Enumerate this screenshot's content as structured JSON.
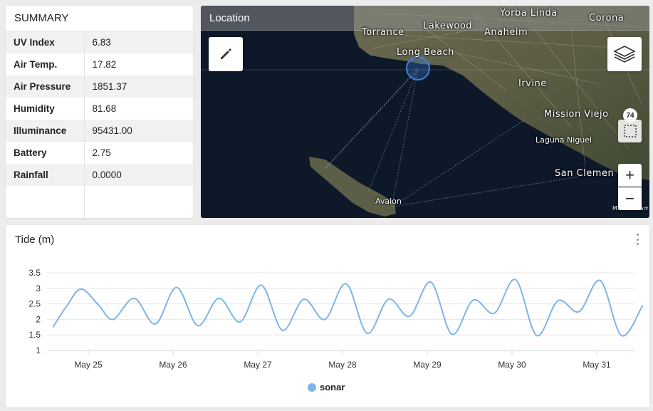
{
  "summary": {
    "title": "SUMMARY",
    "rows": [
      {
        "label": "UV Index",
        "value": "6.83"
      },
      {
        "label": "Air Temp.",
        "value": "17.82"
      },
      {
        "label": "Air Pressure",
        "value": "1851.37"
      },
      {
        "label": "Humidity",
        "value": "81.68"
      },
      {
        "label": "Illuminance",
        "value": "95431.00"
      },
      {
        "label": "Battery",
        "value": "2.75"
      },
      {
        "label": "Rainfall",
        "value": "0.0000"
      }
    ]
  },
  "map": {
    "title": "Location",
    "cluster_count": "74",
    "zoom_in_label": "+",
    "zoom_out_label": "−",
    "places": {
      "torrance": "Torrance",
      "lakewood": "Lakewood",
      "anaheim": "Anaheim",
      "yorba_linda": "Yorba Linda",
      "corona": "Corona",
      "long_beach": "Long Beach",
      "irvine": "Irvine",
      "mission_viejo": "Mission Viejo",
      "laguna_niguel": "Laguna Niguel",
      "san_clemente": "San Clemen",
      "avalon": "Avalon",
      "map_attribution": "M... C... Camp Pen..."
    },
    "icons": [
      "pencil-icon",
      "layers-icon",
      "grid-select-icon"
    ]
  },
  "chart": {
    "title": "Tide (m)",
    "legend_label": "sonar"
  },
  "chart_data": {
    "type": "line",
    "title": "Tide (m)",
    "xlabel": "",
    "ylabel": "",
    "ylim": [
      1,
      3.5
    ],
    "yticks": [
      "1",
      "1.5",
      "2",
      "2.5",
      "3",
      "3.5"
    ],
    "xtick_labels": [
      "May 25",
      "May 26",
      "May 27",
      "May 28",
      "May 29",
      "May 30",
      "May 31"
    ],
    "grid": true,
    "legend_position": "bottom",
    "series": [
      {
        "name": "sonar",
        "color": "#7cb5ec",
        "points": [
          [
            "2024-05-24T14:00",
            1.75
          ],
          [
            "2024-05-24T18:00",
            2.45
          ],
          [
            "2024-05-24T22:00",
            2.98
          ],
          [
            "2024-05-25T03:00",
            2.45
          ],
          [
            "2024-05-25T07:00",
            2.0
          ],
          [
            "2024-05-25T13:00",
            2.68
          ],
          [
            "2024-05-25T19:00",
            1.85
          ],
          [
            "2024-05-26T01:00",
            3.03
          ],
          [
            "2024-05-26T07:00",
            1.8
          ],
          [
            "2024-05-26T13:00",
            2.68
          ],
          [
            "2024-05-26T19:00",
            1.92
          ],
          [
            "2024-05-27T01:00",
            3.1
          ],
          [
            "2024-05-27T07:00",
            1.65
          ],
          [
            "2024-05-27T13:00",
            2.65
          ],
          [
            "2024-05-27T19:00",
            2.0
          ],
          [
            "2024-05-28T01:00",
            3.15
          ],
          [
            "2024-05-28T07:00",
            1.55
          ],
          [
            "2024-05-28T13:00",
            2.65
          ],
          [
            "2024-05-28T19:00",
            2.1
          ],
          [
            "2024-05-29T01:00",
            3.2
          ],
          [
            "2024-05-29T07:00",
            1.52
          ],
          [
            "2024-05-29T13:00",
            2.62
          ],
          [
            "2024-05-29T19:00",
            2.2
          ],
          [
            "2024-05-30T01:00",
            3.28
          ],
          [
            "2024-05-30T07:00",
            1.48
          ],
          [
            "2024-05-30T13:00",
            2.6
          ],
          [
            "2024-05-30T19:00",
            2.25
          ],
          [
            "2024-05-31T01:00",
            3.25
          ],
          [
            "2024-05-31T07:00",
            1.48
          ],
          [
            "2024-05-31T13:00",
            2.45
          ]
        ]
      }
    ]
  }
}
